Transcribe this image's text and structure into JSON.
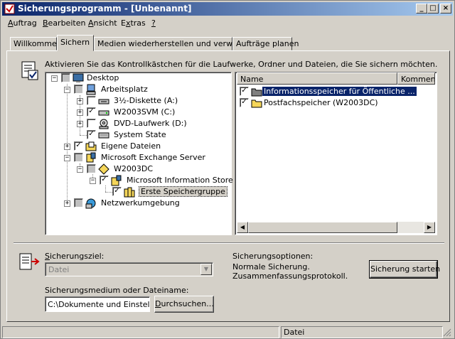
{
  "window": {
    "title": "Sicherungsprogramm - [Unbenannt]",
    "controls": {
      "minimize": "_",
      "maximize": "□",
      "close": "×"
    }
  },
  "menu": [
    {
      "prefix": "",
      "mnemonic": "A",
      "rest": "uftrag"
    },
    {
      "prefix": "",
      "mnemonic": "B",
      "rest": "earbeiten"
    },
    {
      "prefix": "",
      "mnemonic": "A",
      "rest": "nsicht"
    },
    {
      "prefix": "E",
      "mnemonic": "x",
      "rest": "tras"
    },
    {
      "prefix": "",
      "mnemonic": "?",
      "rest": ""
    }
  ],
  "tabs": {
    "welcome": "Willkommen",
    "backup": "Sichern",
    "restore": "Medien wiederherstellen und verwalten",
    "jobs": "Aufträge planen"
  },
  "instruction": "Aktivieren Sie das Kontrollkästchen für die Laufwerke, Ordner und Dateien, die Sie sichern möchten.",
  "tree": {
    "desktop": "Desktop",
    "my_computer": "Arbeitsplatz",
    "floppy": "3½-Diskette (A:)",
    "c_drive": "W2003SVM (C:)",
    "dvd": "DVD-Laufwerk (D:)",
    "system_state": "System State",
    "my_documents": "Eigene Dateien",
    "exchange": "Microsoft Exchange Server",
    "server": "W2003DC",
    "info_store": "Microsoft Information Store",
    "storage_group": "Erste Speichergruppe",
    "network": "Netzwerkumgebung"
  },
  "list": {
    "columns": {
      "name": "Name",
      "comment": "Kommentar"
    },
    "rows": [
      "Informationsspeicher für Öffentliche ...",
      "Postfachspeicher (W2003DC)"
    ]
  },
  "bottom": {
    "target_label": "Sicherungsziel:",
    "target_mnemonic_rest": "icherungsziel:",
    "target_value": "Datei",
    "medium_label": "Sicherungsmedium oder Dateiname:",
    "medium_value": "C:\\Dokumente und Einstellun",
    "browse_label": "Durchsuchen...",
    "options_title": "Sicherungsoptionen:",
    "options_line1": "Normale Sicherung.",
    "options_line2": "Zusammenfassungsprotokoll.",
    "start_label": "Sicherung starten"
  },
  "status": {
    "pane2": "Datei"
  },
  "colors": {
    "titlebar_start": "#0a246a",
    "titlebar_end": "#a6caf0",
    "face": "#d4d0c8",
    "check": "#000000",
    "folder": "#f5d65a",
    "selection": "#0a246a"
  }
}
